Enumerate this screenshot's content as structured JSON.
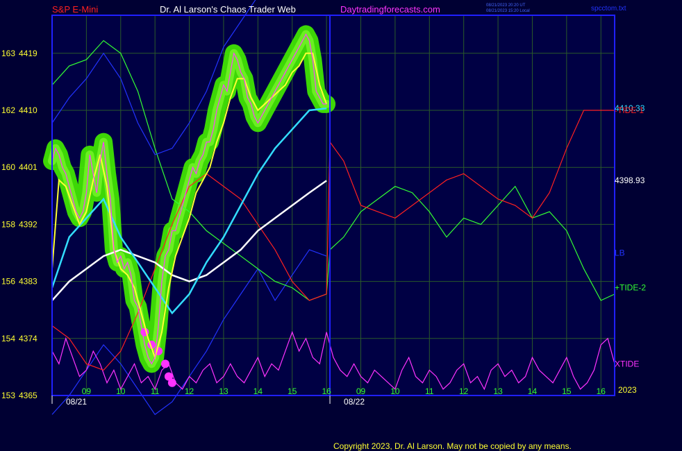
{
  "header": {
    "left_title": "S&P E-Mini",
    "center_title": "Dr. Al Larson's Chaos Trader Web",
    "site": "Daytradingforecasts.com",
    "time_ut": "08/21/2023 20:20 UT",
    "time_local": "08/21/2023 15:20 Local",
    "file": "spcctom.txt"
  },
  "footer": {
    "copyright": "Copyright 2023, Dr. Al Larson. May not be copied by any means."
  },
  "colors": {
    "background": "#000033",
    "plot_bg": "#000044",
    "axis": "#2020ff",
    "grid": "#2a5a2a",
    "price": "#ff40ff",
    "yellow": "#ffff33",
    "cyan": "#33ddff",
    "white": "#ffffff",
    "green": "#33ff33",
    "red": "#ff2020",
    "blue": "#2233ff",
    "magenta": "#ff33ff",
    "glow": "#44ee00"
  },
  "chart_data": {
    "type": "line",
    "y_left_ticks": [
      {
        "a": "153",
        "b": "4365",
        "v": 4365
      },
      {
        "a": "154",
        "b": "4374",
        "v": 4374
      },
      {
        "a": "156",
        "b": "4383",
        "v": 4383
      },
      {
        "a": "158",
        "b": "4392",
        "v": 4392
      },
      {
        "a": "160",
        "b": "4401",
        "v": 4401
      },
      {
        "a": "162",
        "b": "4410",
        "v": 4410
      },
      {
        "a": "163",
        "b": "4419",
        "v": 4419
      }
    ],
    "ylim": [
      4365,
      4425
    ],
    "x_ticks": [
      "09",
      "10",
      "11",
      "12",
      "13",
      "14",
      "15",
      "16",
      "09",
      "10",
      "11",
      "12",
      "13",
      "14",
      "15",
      "16"
    ],
    "x_tick_pos": [
      0.5,
      1.5,
      2.5,
      3.5,
      4.5,
      5.5,
      6.5,
      7.5,
      8.5,
      9.5,
      10.5,
      11.5,
      12.5,
      13.5,
      14.5,
      15.5
    ],
    "xlim": [
      -0.5,
      15.9
    ],
    "date_labels": [
      {
        "text": "08/21",
        "x": -0.5
      },
      {
        "text": "08/22",
        "x": 7.6
      }
    ],
    "year_label": "2023",
    "right_labels": [
      {
        "text": "4410.33",
        "y": 4410.33,
        "color": "#33ddff"
      },
      {
        "text": "-TIDE-1",
        "y": 4410,
        "color": "#ff2020"
      },
      {
        "text": "4398.93",
        "y": 4398.93,
        "color": "#ffffff"
      },
      {
        "text": "LB",
        "y": 4387.5,
        "color": "#2233ff"
      },
      {
        "text": "+TIDE-2",
        "y": 4382,
        "color": "#33ff33"
      },
      {
        "text": "XTIDE",
        "y": 4370,
        "color": "#ff33ff"
      }
    ],
    "series": [
      {
        "name": "price",
        "color": "#ff40ff",
        "x": [
          -0.5,
          -0.4,
          -0.3,
          -0.2,
          -0.1,
          0,
          0.1,
          0.2,
          0.3,
          0.4,
          0.5,
          0.6,
          0.7,
          0.8,
          0.9,
          1.0,
          1.1,
          1.2,
          1.3,
          1.4,
          1.5,
          1.6,
          1.7,
          1.8,
          1.9,
          2.0,
          2.1,
          2.2,
          2.3,
          2.4,
          2.5,
          2.6,
          2.7,
          2.8,
          2.9,
          3.0,
          3.1,
          3.2,
          3.3,
          3.4,
          3.5,
          3.6,
          3.7,
          3.8,
          3.9,
          4.0,
          4.1,
          4.2,
          4.3,
          4.4,
          4.5,
          4.6,
          4.7,
          4.8,
          4.9,
          5.0,
          5.1,
          5.2,
          5.3,
          5.4,
          5.5,
          5.6,
          5.7,
          5.8,
          5.9,
          6.0,
          6.1,
          6.2,
          6.3,
          6.4,
          6.5,
          6.6,
          6.7,
          6.8,
          6.9,
          7.0,
          7.1,
          7.2,
          7.3,
          7.4,
          7.5
        ],
        "y": [
          4402,
          4404,
          4403,
          4401,
          4400,
          4398,
          4396,
          4394,
          4393,
          4394,
          4397,
          4403,
          4400,
          4397,
          4402,
          4405,
          4400,
          4396,
          4388,
          4386,
          4387,
          4385,
          4386,
          4384,
          4380,
          4379,
          4376,
          4373,
          4371,
          4370,
          4371,
          4376,
          4383,
          4387,
          4388,
          4391,
          4391,
          4393,
          4395,
          4397,
          4399,
          4401,
          4400,
          4402,
          4403,
          4405,
          4405,
          4407,
          4410,
          4412,
          4414,
          4413,
          4416,
          4419,
          4418,
          4416,
          4415,
          4412,
          4411,
          4409,
          4408,
          4409,
          4410,
          4411,
          4412,
          4413,
          4414,
          4415,
          4416,
          4417,
          4418,
          4419,
          4420,
          4421,
          4422,
          4421,
          4418,
          4413,
          4412,
          4411,
          4411
        ]
      },
      {
        "name": "yellow",
        "color": "#ffff33",
        "x": [
          -0.5,
          -0.3,
          -0.1,
          0.1,
          0.3,
          0.5,
          0.7,
          0.9,
          1.1,
          1.3,
          1.5,
          1.7,
          1.9,
          2.1,
          2.3,
          2.5,
          2.7,
          2.9,
          3.1,
          3.3,
          3.5,
          3.7,
          3.9,
          4.1,
          4.3,
          4.5,
          4.7,
          4.9,
          5.1,
          5.3,
          5.5,
          5.7,
          5.9,
          6.1,
          6.3,
          6.5,
          6.7,
          6.9,
          7.1,
          7.3,
          7.5
        ],
        "y": [
          4385,
          4399,
          4398,
          4395,
          4392,
          4394,
          4399,
          4403,
          4398,
          4388,
          4385,
          4384,
          4382,
          4378,
          4374,
          4371,
          4375,
          4382,
          4387,
          4390,
          4393,
          4397,
          4399,
          4401,
          4405,
          4408,
          4412,
          4415,
          4415,
          4412,
          4410,
          4411,
          4412,
          4413,
          4414,
          4416,
          4417,
          4419,
          4419,
          4414,
          4411
        ]
      },
      {
        "name": "cyan",
        "color": "#33ddff",
        "x": [
          -0.5,
          0,
          0.5,
          1.0,
          1.5,
          2.0,
          2.5,
          3.0,
          3.5,
          4.0,
          4.5,
          5.0,
          5.5,
          6.0,
          6.5,
          7.0,
          7.5
        ],
        "y": [
          4382,
          4390,
          4393,
          4396,
          4390,
          4386,
          4382,
          4378,
          4381,
          4386,
          4390,
          4395,
          4400,
          4404,
          4407,
          4410,
          4410.3
        ]
      },
      {
        "name": "white",
        "color": "#ffffff",
        "x": [
          -0.5,
          0,
          0.5,
          1.0,
          1.5,
          2.0,
          2.5,
          3.0,
          3.5,
          4.0,
          4.5,
          5.0,
          5.5,
          6.0,
          6.5,
          7.0,
          7.5
        ],
        "y": [
          4380,
          4383,
          4385,
          4387,
          4388,
          4387,
          4386,
          4384,
          4383,
          4384,
          4386,
          4388,
          4391,
          4393,
          4395,
          4397,
          4398.9
        ]
      },
      {
        "name": "-TIDE-1",
        "color": "#ff2020",
        "x": [
          -0.5,
          0,
          0.5,
          1.0,
          1.5,
          2.0,
          2.5,
          3.0,
          3.5,
          4.0,
          4.5,
          5.0,
          5.5,
          6.0,
          6.5,
          7.0,
          7.5,
          7.6,
          8.0,
          8.5,
          9.0,
          9.5,
          10.0,
          10.5,
          11.0,
          11.5,
          12.0,
          12.5,
          13.0,
          13.5,
          14.0,
          14.5,
          15.0,
          15.5,
          15.9
        ],
        "y": [
          4376,
          4374,
          4370,
          4369,
          4372,
          4378,
          4385,
          4392,
          4398,
          4400,
          4398,
          4396,
          4392,
          4388,
          4383,
          4380,
          4381,
          4405,
          4402,
          4395,
          4394,
          4393,
          4395,
          4397,
          4399,
          4400,
          4398,
          4396,
          4395,
          4393,
          4397,
          4404,
          4410,
          4410,
          4410
        ]
      },
      {
        "name": "+TIDE-2",
        "color": "#33ff33",
        "x": [
          -0.5,
          0,
          0.5,
          1.0,
          1.5,
          2.0,
          2.5,
          3.0,
          3.5,
          4.0,
          4.5,
          5.0,
          5.5,
          6.0,
          6.5,
          7.0,
          7.5,
          7.6,
          8.0,
          8.5,
          9.0,
          9.5,
          10.0,
          10.5,
          11.0,
          11.5,
          12.0,
          12.5,
          13.0,
          13.5,
          14.0,
          14.5,
          15.0,
          15.5,
          15.9
        ],
        "y": [
          4414,
          4417,
          4418,
          4421,
          4419,
          4413,
          4404,
          4396,
          4394,
          4391,
          4389,
          4387,
          4385,
          4383,
          4382,
          4380,
          4381,
          4388,
          4390,
          4394,
          4396,
          4398,
          4397,
          4394,
          4390,
          4393,
          4392,
          4395,
          4398,
          4393,
          4394,
          4391,
          4385,
          4380,
          4381
        ]
      },
      {
        "name": "LB",
        "color": "#2233ff",
        "x": [
          -0.5,
          0,
          0.5,
          1.0,
          1.5,
          2.0,
          2.5,
          3.0,
          3.5,
          4.0,
          4.5,
          5.0,
          5.5,
          6.0,
          6.5,
          7.0,
          7.5
        ],
        "y": [
          4408,
          4412,
          4415,
          4419,
          4415,
          4408,
          4403,
          4404,
          4408,
          4413,
          4420,
          4424,
          4428,
          4432,
          4436,
          4440,
          4442
        ]
      },
      {
        "name": "LB-lower",
        "color": "#2233ff",
        "x": [
          -0.5,
          0,
          0.5,
          1.0,
          1.5,
          2.0,
          2.5,
          3.0,
          3.5,
          4.0,
          4.5,
          5.0,
          5.5,
          6.0,
          6.5,
          7.0,
          7.5
        ],
        "y": [
          4362,
          4365,
          4369,
          4373,
          4370,
          4366,
          4362,
          4364,
          4368,
          4372,
          4377,
          4381,
          4385,
          4380,
          4384,
          4388,
          4387
        ]
      },
      {
        "name": "XTIDE",
        "color": "#ff33ff",
        "x": [
          -0.5,
          -0.3,
          -0.1,
          0.1,
          0.3,
          0.5,
          0.7,
          0.9,
          1.1,
          1.3,
          1.5,
          1.7,
          1.9,
          2.1,
          2.3,
          2.5,
          2.7,
          2.9,
          3.1,
          3.3,
          3.5,
          3.7,
          3.9,
          4.1,
          4.3,
          4.5,
          4.7,
          4.9,
          5.1,
          5.3,
          5.5,
          5.7,
          5.9,
          6.1,
          6.3,
          6.5,
          6.7,
          6.9,
          7.1,
          7.3,
          7.5,
          7.7,
          7.9,
          8.1,
          8.3,
          8.5,
          8.7,
          8.9,
          9.1,
          9.3,
          9.5,
          9.7,
          9.9,
          10.1,
          10.3,
          10.5,
          10.7,
          10.9,
          11.1,
          11.3,
          11.5,
          11.7,
          11.9,
          12.1,
          12.3,
          12.5,
          12.7,
          12.9,
          13.1,
          13.3,
          13.5,
          13.7,
          13.9,
          14.1,
          14.3,
          14.5,
          14.7,
          14.9,
          15.1,
          15.3,
          15.5,
          15.7,
          15.9
        ],
        "y": [
          4372,
          4370,
          4374,
          4371,
          4368,
          4369,
          4372,
          4370,
          4367,
          4369,
          4366,
          4368,
          4370,
          4367,
          4368,
          4366,
          4369,
          4370,
          4367,
          4366,
          4368,
          4367,
          4369,
          4370,
          4367,
          4368,
          4370,
          4368,
          4367,
          4369,
          4371,
          4368,
          4370,
          4369,
          4372,
          4375,
          4372,
          4374,
          4371,
          4370,
          4375,
          4371,
          4369,
          4368,
          4370,
          4368,
          4367,
          4369,
          4368,
          4367,
          4366,
          4369,
          4371,
          4368,
          4367,
          4369,
          4368,
          4366,
          4367,
          4369,
          4370,
          4367,
          4368,
          4366,
          4369,
          4370,
          4368,
          4369,
          4367,
          4368,
          4371,
          4369,
          4368,
          4367,
          4369,
          4371,
          4368,
          4366,
          4367,
          4369,
          4373,
          4374,
          4370
        ]
      }
    ]
  }
}
